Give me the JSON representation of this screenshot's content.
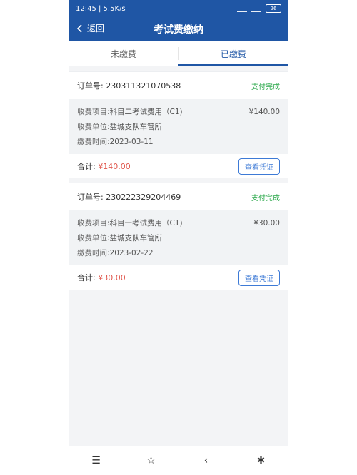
{
  "status_bar": {
    "time_net": "12:45 | 5.5K/s",
    "battery": "26"
  },
  "nav": {
    "back_label": "返回",
    "title": "考试费缴纳"
  },
  "tabs": [
    {
      "label": "未缴费"
    },
    {
      "label": "已缴费"
    }
  ],
  "orders": [
    {
      "order_label": "订单号:",
      "order_no": "230311321070538",
      "status": "支付完成",
      "item_label": "收费项目:",
      "item": "科目二考试费用（C1)",
      "amount": "¥140.00",
      "unit_label": "收费单位:",
      "unit": "盐城支队车管所",
      "time_label": "缴费时间:",
      "time": "2023-03-11",
      "total_label": "合计:",
      "total": "¥140.00",
      "voucher_btn": "查看凭证"
    },
    {
      "order_label": "订单号:",
      "order_no": "230222329204469",
      "status": "支付完成",
      "item_label": "收费项目:",
      "item": "科目一考试费用（C1)",
      "amount": "¥30.00",
      "unit_label": "收费单位:",
      "unit": "盐城支队车管所",
      "time_label": "缴费时间:",
      "time": "2023-02-22",
      "total_label": "合计:",
      "total": "¥30.00",
      "voucher_btn": "查看凭证"
    }
  ],
  "bottom_nav": {
    "menu": "☰",
    "home": "☆",
    "back": "‹",
    "accessibility": "✱"
  },
  "colors": {
    "brand": "#1f56a5",
    "success": "#2aa84a",
    "price": "#e0584e"
  }
}
